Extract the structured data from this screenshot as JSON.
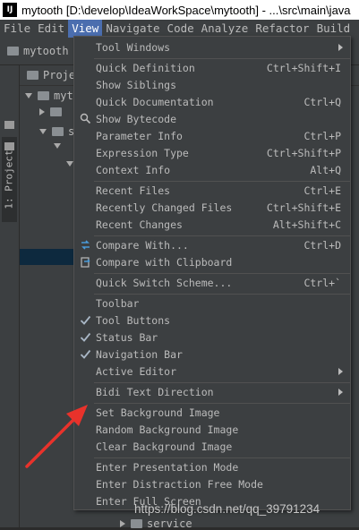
{
  "window": {
    "app_badge": "IJ",
    "title": "mytooth [D:\\develop\\IdeaWorkSpace\\mytooth] - ...\\src\\main\\java"
  },
  "menubar": {
    "items": [
      {
        "label": "File"
      },
      {
        "label": "Edit"
      },
      {
        "label": "View"
      },
      {
        "label": "Navigate"
      },
      {
        "label": "Code"
      },
      {
        "label": "Analyze"
      },
      {
        "label": "Refactor"
      },
      {
        "label": "Build"
      }
    ]
  },
  "navbar": {
    "project": "mytooth"
  },
  "toolwindow": {
    "tab_label": "1: Project",
    "header": "Proje",
    "tree": [
      {
        "label": "myto",
        "expanded": true
      },
      {
        "label": "",
        "expanded": false
      },
      {
        "label": "s",
        "expanded": true
      },
      {
        "label": "",
        "expanded": true
      },
      {
        "label": "",
        "expanded": true
      },
      {
        "label": "service",
        "expanded": false
      }
    ]
  },
  "view_menu": {
    "items": [
      {
        "label": "Tool Windows",
        "shortcut": "",
        "submenu": true,
        "checked": false
      },
      {
        "label": "Quick Definition",
        "shortcut": "Ctrl+Shift+I",
        "submenu": false,
        "checked": false
      },
      {
        "label": "Show Siblings",
        "shortcut": "",
        "submenu": false,
        "checked": false
      },
      {
        "label": "Quick Documentation",
        "shortcut": "Ctrl+Q",
        "submenu": false,
        "checked": false
      },
      {
        "label": "Show Bytecode",
        "shortcut": "",
        "submenu": false,
        "checked": false
      },
      {
        "label": "Parameter Info",
        "shortcut": "Ctrl+P",
        "submenu": false,
        "checked": false
      },
      {
        "label": "Expression Type",
        "shortcut": "Ctrl+Shift+P",
        "submenu": false,
        "checked": false
      },
      {
        "label": "Context Info",
        "shortcut": "Alt+Q",
        "submenu": false,
        "checked": false
      },
      {
        "label": "Recent Files",
        "shortcut": "Ctrl+E",
        "submenu": false,
        "checked": false
      },
      {
        "label": "Recently Changed Files",
        "shortcut": "Ctrl+Shift+E",
        "submenu": false,
        "checked": false
      },
      {
        "label": "Recent Changes",
        "shortcut": "Alt+Shift+C",
        "submenu": false,
        "checked": false
      },
      {
        "label": "Compare With...",
        "shortcut": "Ctrl+D",
        "submenu": false,
        "checked": false
      },
      {
        "label": "Compare with Clipboard",
        "shortcut": "",
        "submenu": false,
        "checked": false
      },
      {
        "label": "Quick Switch Scheme...",
        "shortcut": "Ctrl+`",
        "submenu": false,
        "checked": false
      },
      {
        "label": "Toolbar",
        "shortcut": "",
        "submenu": false,
        "checked": false
      },
      {
        "label": "Tool Buttons",
        "shortcut": "",
        "submenu": false,
        "checked": true
      },
      {
        "label": "Status Bar",
        "shortcut": "",
        "submenu": false,
        "checked": true
      },
      {
        "label": "Navigation Bar",
        "shortcut": "",
        "submenu": false,
        "checked": true
      },
      {
        "label": "Active Editor",
        "shortcut": "",
        "submenu": true,
        "checked": false
      },
      {
        "label": "Bidi Text Direction",
        "shortcut": "",
        "submenu": true,
        "checked": false
      },
      {
        "label": "Set Background Image",
        "shortcut": "",
        "submenu": false,
        "checked": false
      },
      {
        "label": "Random Background Image",
        "shortcut": "",
        "submenu": false,
        "checked": false
      },
      {
        "label": "Clear Background Image",
        "shortcut": "",
        "submenu": false,
        "checked": false
      },
      {
        "label": "Enter Presentation Mode",
        "shortcut": "",
        "submenu": false,
        "checked": false
      },
      {
        "label": "Enter Distraction Free Mode",
        "shortcut": "",
        "submenu": false,
        "checked": false
      },
      {
        "label": "Enter Full Screen",
        "shortcut": "",
        "submenu": false,
        "checked": false
      }
    ]
  },
  "watermark": "https://blog.csdn.net/qq_39791234",
  "colors": {
    "menu_bg": "#3c3f41",
    "menu_highlight": "#4b6eaf",
    "annotation_arrow": "#e8322b",
    "checkmark": "#a9b7c6",
    "compare_icon": "#4a9ad8"
  }
}
